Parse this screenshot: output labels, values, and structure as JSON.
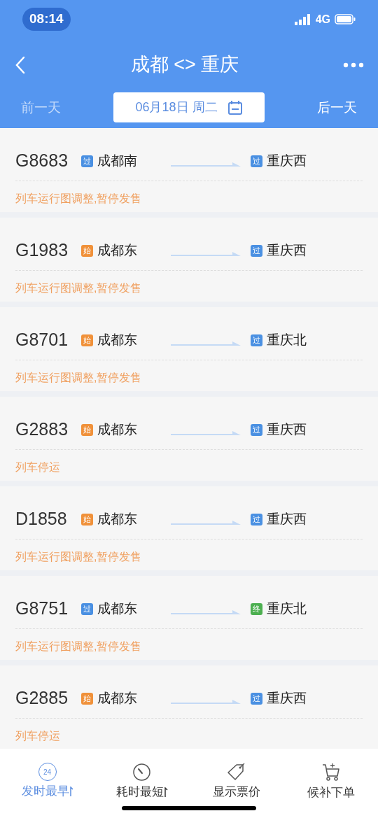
{
  "status_bar": {
    "time": "08:14",
    "network": "4G"
  },
  "nav": {
    "title": "成都 <> 重庆"
  },
  "date_bar": {
    "prev": {
      "label": "前一天",
      "disabled": true
    },
    "date": "06月18日 周二",
    "next": {
      "label": "后一天",
      "disabled": false
    }
  },
  "trains": [
    {
      "number": "G8683",
      "from": {
        "badge": "过",
        "kind": "pass",
        "station": "成都南"
      },
      "to": {
        "badge": "过",
        "kind": "pass",
        "station": "重庆西"
      },
      "note": "列车运行图调整,暂停发售"
    },
    {
      "number": "G1983",
      "from": {
        "badge": "始",
        "kind": "start",
        "station": "成都东"
      },
      "to": {
        "badge": "过",
        "kind": "pass",
        "station": "重庆西"
      },
      "note": "列车运行图调整,暂停发售"
    },
    {
      "number": "G8701",
      "from": {
        "badge": "始",
        "kind": "start",
        "station": "成都东"
      },
      "to": {
        "badge": "过",
        "kind": "pass",
        "station": "重庆北"
      },
      "note": "列车运行图调整,暂停发售"
    },
    {
      "number": "G2883",
      "from": {
        "badge": "始",
        "kind": "start",
        "station": "成都东"
      },
      "to": {
        "badge": "过",
        "kind": "pass",
        "station": "重庆西"
      },
      "note": "列车停运"
    },
    {
      "number": "D1858",
      "from": {
        "badge": "始",
        "kind": "start",
        "station": "成都东"
      },
      "to": {
        "badge": "过",
        "kind": "pass",
        "station": "重庆西"
      },
      "note": "列车运行图调整,暂停发售"
    },
    {
      "number": "G8751",
      "from": {
        "badge": "过",
        "kind": "pass",
        "station": "成都东"
      },
      "to": {
        "badge": "终",
        "kind": "end",
        "station": "重庆北"
      },
      "note": "列车运行图调整,暂停发售"
    },
    {
      "number": "G2885",
      "from": {
        "badge": "始",
        "kind": "start",
        "station": "成都东"
      },
      "to": {
        "badge": "过",
        "kind": "pass",
        "station": "重庆西"
      },
      "note": "列车停运"
    }
  ],
  "toolbar": [
    {
      "kind": "clock24",
      "icon_text": "24",
      "label": "发时最早",
      "selected": true,
      "sortable": true
    },
    {
      "kind": "timer",
      "label": "耗时最短",
      "selected": false,
      "sortable": true
    },
    {
      "kind": "tag",
      "label": "显示票价",
      "selected": false,
      "sortable": false
    },
    {
      "kind": "cart",
      "label": "候补下单",
      "selected": false,
      "sortable": false
    }
  ]
}
